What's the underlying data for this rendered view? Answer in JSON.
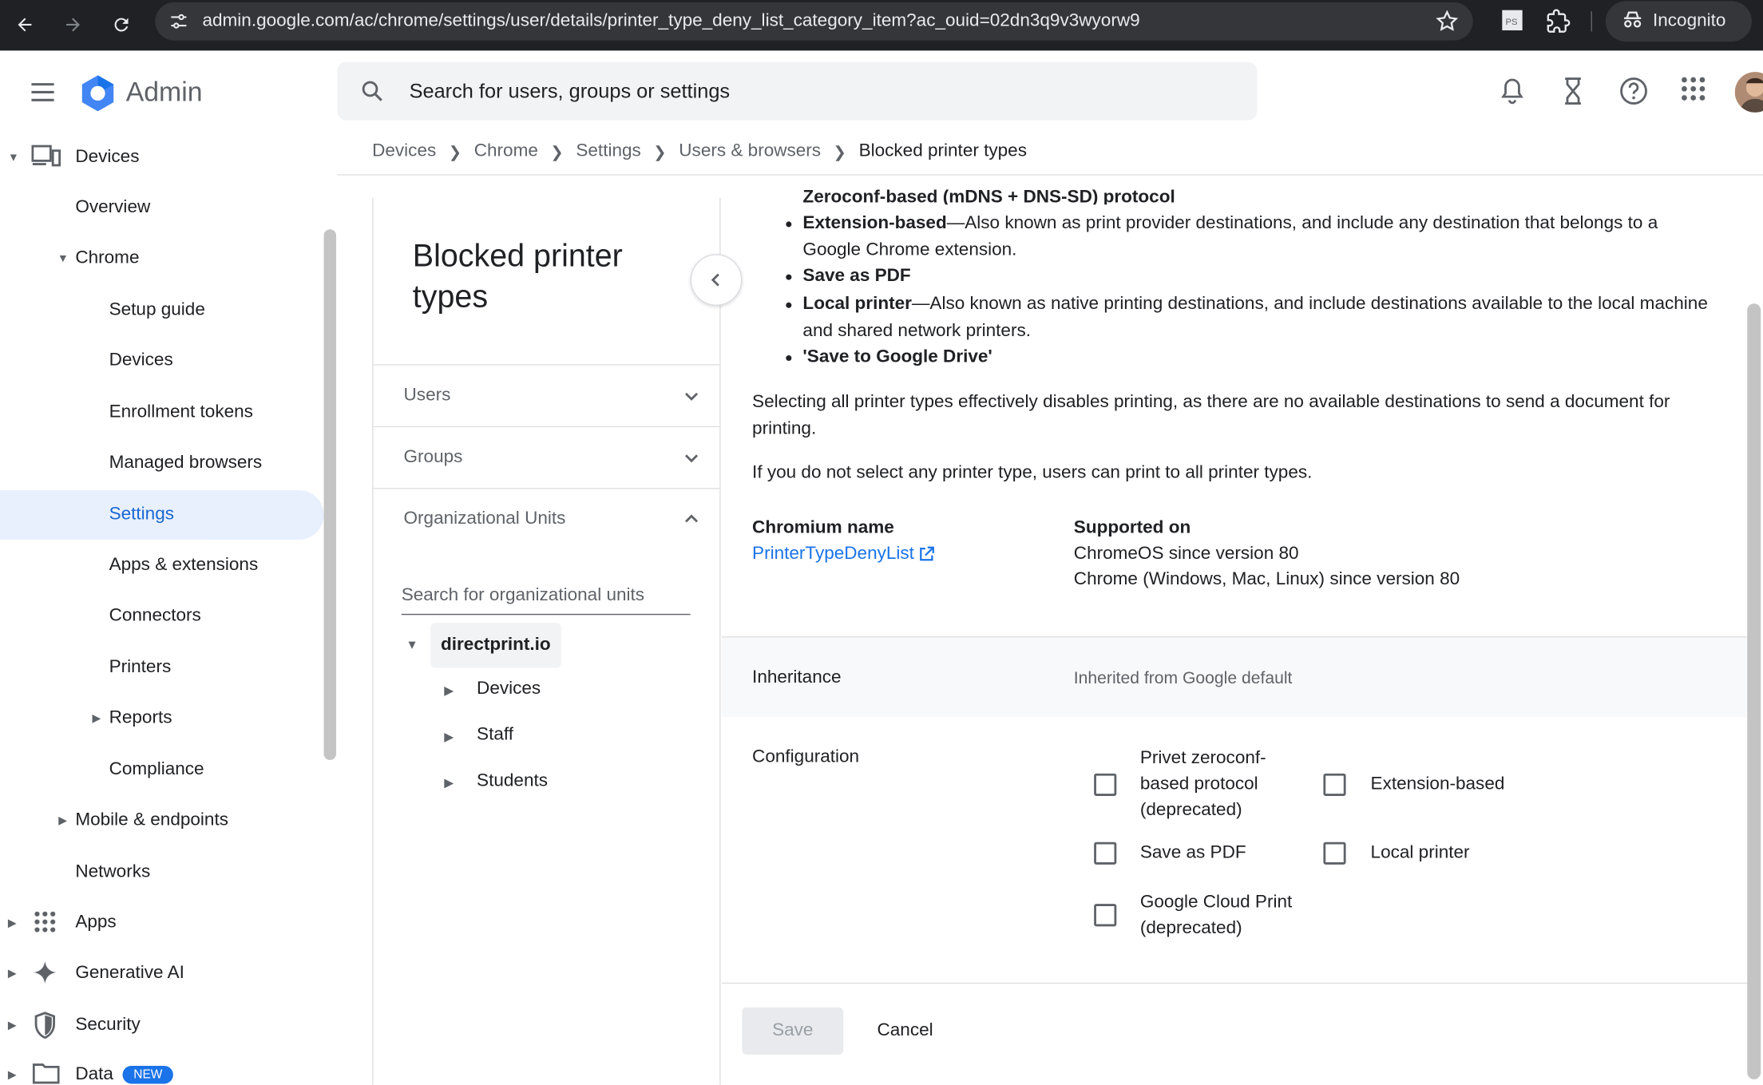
{
  "browser": {
    "url": "admin.google.com/ac/chrome/settings/user/details/printer_type_deny_list_category_item?ac_ouid=02dn3q9v3wyorw9",
    "incognito_label": "Incognito"
  },
  "header": {
    "logo_text": "Admin",
    "search_placeholder": "Search for users, groups or settings"
  },
  "breadcrumb": {
    "items": [
      "Devices",
      "Chrome",
      "Settings",
      "Users & browsers"
    ],
    "current": "Blocked printer types"
  },
  "sidebar": {
    "devices": "Devices",
    "overview": "Overview",
    "chrome": "Chrome",
    "setup_guide": "Setup guide",
    "chrome_devices": "Devices",
    "enrollment_tokens": "Enrollment tokens",
    "managed_browsers": "Managed browsers",
    "settings": "Settings",
    "apps_extensions": "Apps & extensions",
    "connectors": "Connectors",
    "printers": "Printers",
    "reports": "Reports",
    "compliance": "Compliance",
    "mobile_endpoints": "Mobile & endpoints",
    "networks": "Networks",
    "apps": "Apps",
    "generative_ai": "Generative AI",
    "security": "Security",
    "data": "Data",
    "data_badge": "NEW"
  },
  "panel": {
    "title": "Blocked printer types",
    "users": "Users",
    "groups": "Groups",
    "org_units": "Organizational Units",
    "ou_search_placeholder": "Search for organizational units",
    "tree": {
      "root": "directprint.io",
      "children": [
        "Devices",
        "Staff",
        "Students"
      ]
    }
  },
  "content": {
    "bullet_top_partial": "Zeroconf-based (mDNS + DNS-SD) protocol",
    "bullet1_bold": "Extension-based",
    "bullet1_text": "—Also known as print provider destinations, and include any destination that belongs to a Google Chrome extension.",
    "bullet2_bold": "Save as PDF",
    "bullet3_bold": "Local printer",
    "bullet3_text": "—Also known as native printing destinations, and include destinations available to the local machine and shared network printers.",
    "bullet4_bold": "'Save to Google Drive'",
    "para1": "Selecting all printer types effectively disables printing, as there are no available destinations to send a document for printing.",
    "para2": "If you do not select any printer type, users can print to all printer types.",
    "chromium_name_label": "Chromium name",
    "chromium_name_link": "PrinterTypeDenyList",
    "supported_on_label": "Supported on",
    "supported_lines": [
      "ChromeOS since version 80",
      "Chrome (Windows, Mac, Linux) since version 80"
    ],
    "inheritance_label": "Inheritance",
    "inheritance_value": "Inherited from Google default",
    "configuration_label": "Configuration",
    "options": {
      "privet": "Privet zeroconf-based protocol (deprecated)",
      "extension": "Extension-based",
      "pdf": "Save as PDF",
      "local": "Local printer",
      "cloud": "Google Cloud Print (deprecated)"
    },
    "save_label": "Save",
    "cancel_label": "Cancel"
  },
  "colors": {
    "accent": "#1a73e8",
    "active_bg": "#e8f0fe",
    "browser_bg": "#202124"
  }
}
